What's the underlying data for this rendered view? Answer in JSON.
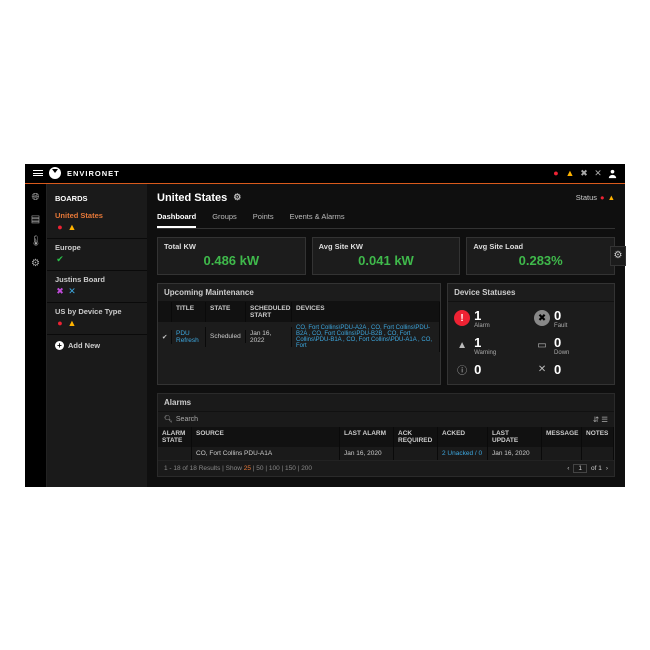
{
  "app": {
    "name": "ENVIRONET"
  },
  "topbar": {
    "icons": [
      "alarm",
      "warning",
      "fault",
      "tools",
      "user"
    ]
  },
  "iconbar": [
    "globe",
    "clipboard",
    "thermometer",
    "gear"
  ],
  "sidebar": {
    "heading": "BOARDS",
    "items": [
      {
        "name": "United States",
        "badges": [
          "alarm-red",
          "warn-yellow"
        ],
        "active": true
      },
      {
        "name": "Europe",
        "badges": [
          "check-green"
        ]
      },
      {
        "name": "Justins Board",
        "badges": [
          "x-magenta",
          "tools-blue"
        ]
      },
      {
        "name": "US by Device Type",
        "badges": [
          "alarm-red",
          "warn-yellow"
        ]
      }
    ],
    "add_label": "Add New"
  },
  "page": {
    "title": "United States",
    "status_label": "Status"
  },
  "tabs": [
    {
      "label": "Dashboard",
      "active": true
    },
    {
      "label": "Groups"
    },
    {
      "label": "Points"
    },
    {
      "label": "Events & Alarms"
    }
  ],
  "kpis": [
    {
      "label": "Total KW",
      "value": "0.486 kW"
    },
    {
      "label": "Avg Site KW",
      "value": "0.041 kW"
    },
    {
      "label": "Avg Site Load",
      "value": "0.283%"
    }
  ],
  "maintenance": {
    "title": "Upcoming Maintenance",
    "columns": [
      "",
      "TITLE",
      "STATE",
      "SCHEDULED START",
      "DEVICES"
    ],
    "rows": [
      {
        "checked": true,
        "title": "PDU Refresh",
        "state": "Scheduled",
        "scheduled": "Jan 16, 2022",
        "devices": "CO, Fort Collins\\PDU-A2A , CO, Fort Collins\\PDU-B2A , CO, Fort Collins\\PDU-B2B , CO, Fort Collins\\PDU-B1A , CO, Fort Collins\\PDU-A1A , CO, Fort"
      }
    ]
  },
  "device_statuses": {
    "title": "Device Statuses",
    "items": [
      {
        "icon": "alarm",
        "label": "Alarm",
        "value": "1",
        "color": "#e23"
      },
      {
        "icon": "fault",
        "label": "Fault",
        "value": "0",
        "color": "#888"
      },
      {
        "icon": "warning",
        "label": "Warning",
        "value": "1",
        "color": "#ffb300"
      },
      {
        "icon": "down",
        "label": "Down",
        "value": "0",
        "color": "#aaa"
      },
      {
        "icon": "info",
        "label": "",
        "value": "0",
        "color": "#ccc"
      },
      {
        "icon": "tools",
        "label": "",
        "value": "0",
        "color": "#aaa"
      }
    ]
  },
  "alarms": {
    "title": "Alarms",
    "search_placeholder": "Search",
    "columns": [
      "ALARM STATE",
      "SOURCE",
      "LAST ALARM",
      "ACK REQUIRED",
      "ACKED",
      "LAST UPDATE",
      "MESSAGE",
      "NOTES"
    ],
    "rows": [
      {
        "state": "",
        "source": "CO, Fort Collins PDU-A1A",
        "last_alarm": "Jan 16, 2020",
        "ack_required": "",
        "acked": "2 Unacked / 0",
        "last_update": "Jan 16, 2020",
        "message": "",
        "notes": ""
      }
    ],
    "pager": {
      "results_text": "1 - 18 of 18 Results | Show",
      "page_sizes": [
        "25",
        "50",
        "100",
        "150",
        "200"
      ],
      "current_size": "25",
      "page_current": "1",
      "page_total": "of 1"
    }
  }
}
